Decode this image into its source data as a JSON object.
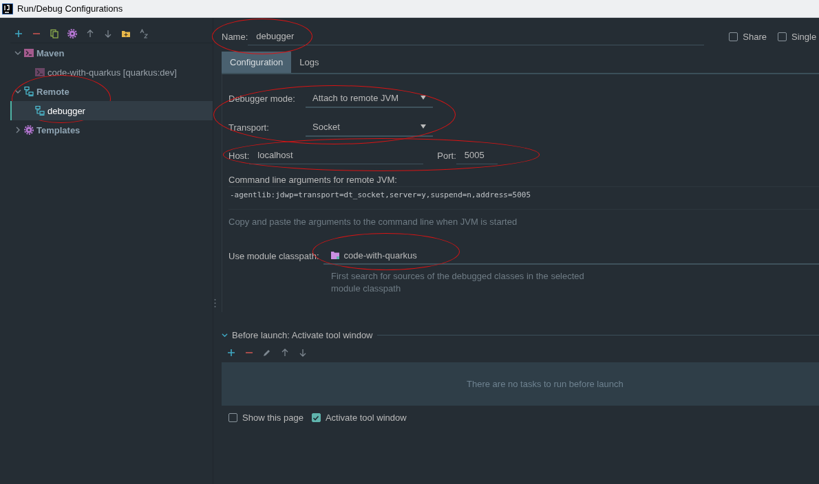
{
  "window": {
    "title": "Run/Debug Configurations"
  },
  "sidebar": {
    "toolbar": [
      {
        "kind": "add"
      },
      {
        "kind": "remove"
      },
      {
        "kind": "copy"
      },
      {
        "kind": "settings"
      },
      {
        "kind": "up"
      },
      {
        "kind": "down"
      },
      {
        "kind": "folder"
      },
      {
        "kind": "sort"
      }
    ],
    "tree": [
      {
        "label": "Maven",
        "kind": "maven",
        "expanded": true,
        "selected": false,
        "circled": false,
        "children": [
          {
            "label": "code-with-quarkus [quarkus:dev]",
            "kind": "maven",
            "selected": false
          }
        ]
      },
      {
        "label": "Remote",
        "kind": "remote",
        "expanded": true,
        "selected": false,
        "circled": true,
        "children": [
          {
            "label": "debugger",
            "kind": "remote",
            "selected": true
          }
        ]
      },
      {
        "label": "Templates",
        "kind": "templates",
        "expanded": false,
        "selected": false,
        "circled": false
      }
    ]
  },
  "name_field": {
    "label": "Name:",
    "value": "debugger",
    "circled": true
  },
  "options": [
    {
      "label": "Share",
      "checked": false
    },
    {
      "label": "Single",
      "checked": false
    }
  ],
  "tabs": [
    {
      "label": "Configuration",
      "selected": true
    },
    {
      "label": "Logs",
      "selected": false
    }
  ],
  "connection": {
    "circled": true,
    "debugger_mode": {
      "label": "Debugger mode:",
      "value": "Attach to remote JVM"
    },
    "transport": {
      "label": "Transport:",
      "value": "Socket"
    }
  },
  "address": {
    "circled": true,
    "host": {
      "label": "Host:",
      "value": "localhost"
    },
    "port": {
      "label": "Port:",
      "value": "5005"
    }
  },
  "command_line": {
    "label": "Command line arguments for remote JVM:",
    "value": "-agentlib:jdwp=transport=dt_socket,server=y,suspend=n,address=5005",
    "hint": "Copy and paste the arguments to the command line when JVM is started"
  },
  "module": {
    "label": "Use module classpath:",
    "value": "code-with-quarkus",
    "circled": true,
    "hint": "First search for sources of the debugged classes in the selected module classpath"
  },
  "before_launch": {
    "title": "Before launch: Activate tool window",
    "expanded": true,
    "toolbar": [
      {
        "kind": "add"
      },
      {
        "kind": "remove"
      },
      {
        "kind": "edit"
      },
      {
        "kind": "up"
      },
      {
        "kind": "down"
      }
    ],
    "empty_text": "There are no tasks to run before launch",
    "options": [
      {
        "label": "Show this page",
        "checked": false
      },
      {
        "label": "Activate tool window",
        "checked": true
      }
    ]
  }
}
